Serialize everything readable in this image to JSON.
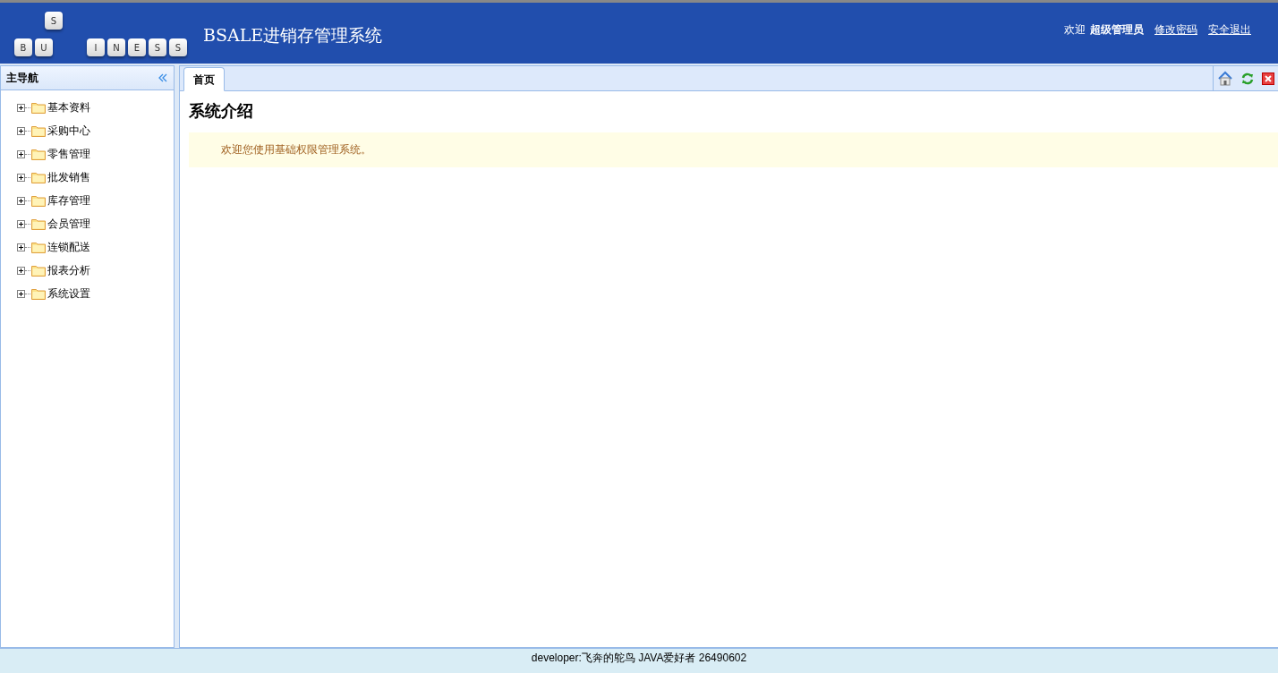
{
  "header": {
    "logo_letters": [
      "B",
      "U",
      "S",
      "I",
      "N",
      "E",
      "S",
      "S"
    ],
    "title": "BSALE进销存管理系统",
    "welcome": "欢迎",
    "user": "超级管理员",
    "links": [
      "修改密码",
      "安全退出"
    ]
  },
  "sidebar": {
    "title": "主导航",
    "items": [
      {
        "label": "基本资料",
        "expanded": false
      },
      {
        "label": "采购中心",
        "expanded": false
      },
      {
        "label": "零售管理",
        "expanded": false
      },
      {
        "label": "批发销售",
        "expanded": false
      },
      {
        "label": "库存管理",
        "expanded": false
      },
      {
        "label": "会员管理",
        "expanded": false
      },
      {
        "label": "连锁配送",
        "expanded": false
      },
      {
        "label": "报表分析",
        "expanded": false
      },
      {
        "label": "系统设置",
        "expanded": false
      }
    ]
  },
  "tabs": [
    {
      "label": "首页",
      "selected": true
    }
  ],
  "content": {
    "heading": "系统介绍",
    "message": "欢迎您使用基础权限管理系统。"
  },
  "footer": "developer:飞奔的鸵鸟 JAVA爱好者 26490602"
}
